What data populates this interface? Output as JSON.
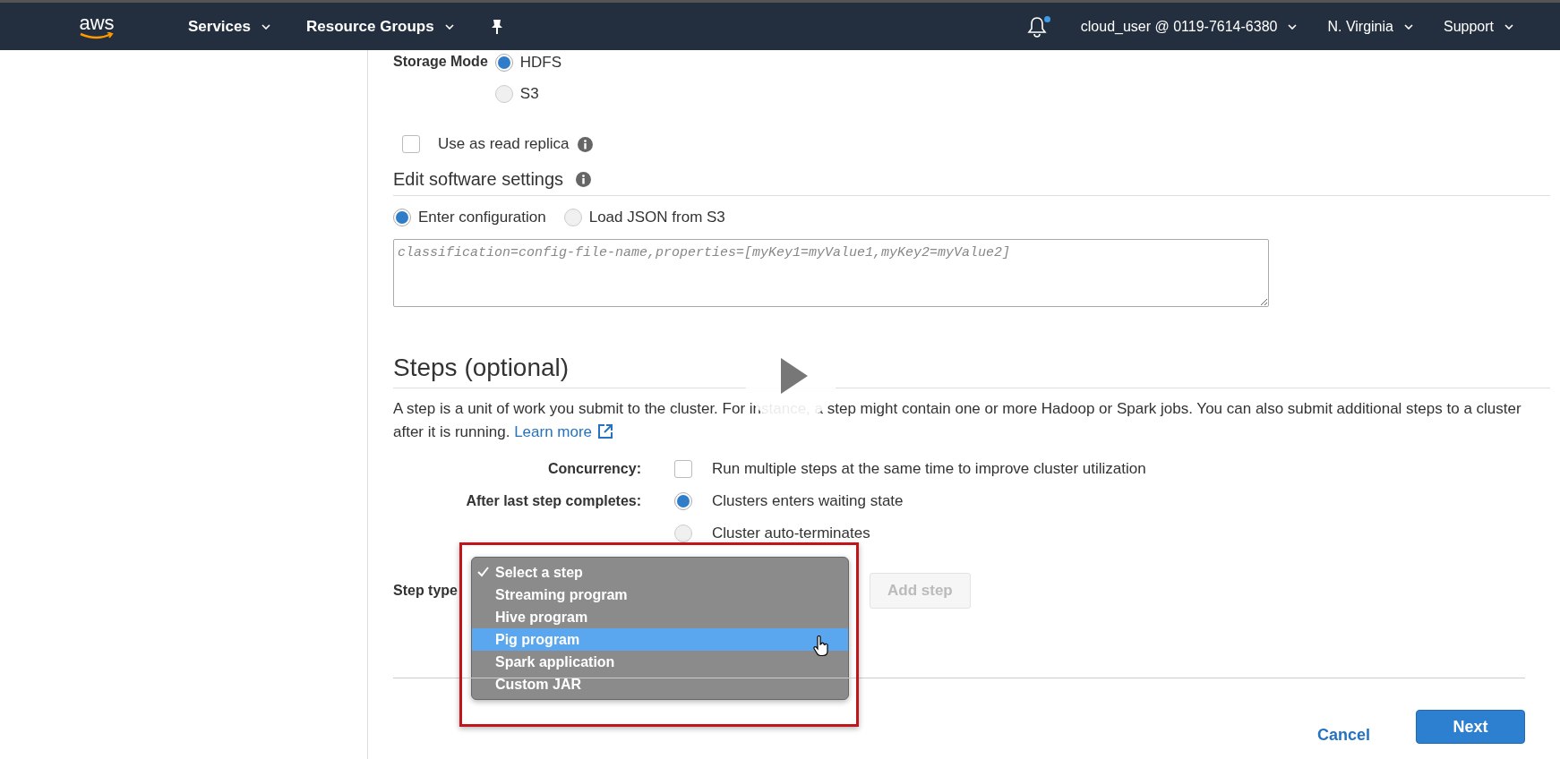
{
  "nav": {
    "logo": "aws",
    "items": [
      {
        "label": "Services"
      },
      {
        "label": "Resource Groups"
      }
    ],
    "notifications": {
      "unread": true
    },
    "account": "cloud_user @ 0119-7614-6380",
    "region": "N. Virginia",
    "support": "Support"
  },
  "storage_mode": {
    "label": "Storage Mode",
    "options": [
      {
        "label": "HDFS",
        "selected": true
      },
      {
        "label": "S3",
        "selected": false
      }
    ]
  },
  "read_replica": {
    "label": "Use as read replica",
    "checked": false
  },
  "software_settings": {
    "title": "Edit software settings",
    "sources": [
      {
        "label": "Enter configuration",
        "selected": true
      },
      {
        "label": "Load JSON from S3",
        "selected": false
      }
    ],
    "config": {
      "placeholder": "classification=config-file-name,properties=[myKey1=myValue1,myKey2=myValue2]"
    }
  },
  "steps": {
    "title": "Steps (optional)",
    "description": "A step is a unit of work you submit to the cluster. For instance, a step might contain one or more Hadoop or Spark jobs. You can also submit additional steps to a cluster after it is running.",
    "learn_more": "Learn more",
    "concurrency": {
      "label": "Concurrency:",
      "option": "Run multiple steps at the same time to improve cluster utilization",
      "checked": false
    },
    "after_last_step": {
      "label": "After last step completes:",
      "options": [
        {
          "label": "Clusters enters waiting state",
          "selected": true
        },
        {
          "label": "Cluster auto-terminates",
          "selected": false
        }
      ]
    },
    "step_type": {
      "label": "Step type",
      "menu": [
        {
          "label": "Select a step",
          "checked": true,
          "selected": false
        },
        {
          "label": "Streaming program",
          "checked": false,
          "selected": false
        },
        {
          "label": "Hive program",
          "checked": false,
          "selected": false
        },
        {
          "label": "Pig program",
          "checked": false,
          "selected": true
        },
        {
          "label": "Spark application",
          "checked": false,
          "selected": false
        },
        {
          "label": "Custom JAR",
          "checked": false,
          "selected": false
        }
      ],
      "add_button": "Add step"
    }
  },
  "footer": {
    "cancel": "Cancel",
    "next": "Next"
  }
}
